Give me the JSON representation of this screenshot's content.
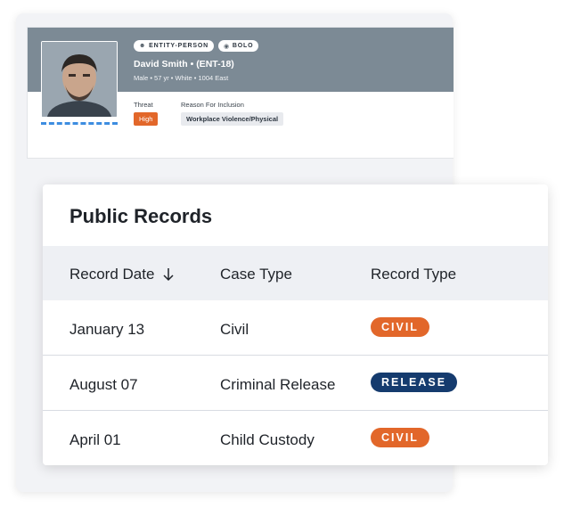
{
  "entity_card": {
    "tags": [
      {
        "icon": "person-icon",
        "label": "ENTITY-PERSON"
      },
      {
        "icon": "eye-icon",
        "label": "BOLO"
      }
    ],
    "name": "David Smith • (ENT-18)",
    "meta": "Male • 57 yr • White • 1004 East",
    "threat_label": "Threat",
    "threat_value": "High",
    "reason_label": "Reason For Inclusion",
    "reason_value": "Workplace Violence/Physical"
  },
  "public_records": {
    "title": "Public Records",
    "columns": [
      {
        "label": "Record Date",
        "sort_icon": "arrow-down-icon"
      },
      {
        "label": "Case Type"
      },
      {
        "label": "Record Type"
      }
    ],
    "rows": [
      {
        "date": "January 13",
        "case_type": "Civil",
        "record_type": "CIVIL",
        "record_color": "#e2672a"
      },
      {
        "date": "August 07",
        "case_type": "Criminal Release",
        "record_type": "RELEASE",
        "record_color": "#153b6e"
      },
      {
        "date": "April 01",
        "case_type": "Child Custody",
        "record_type": "CIVIL",
        "record_color": "#e2672a"
      }
    ]
  },
  "colors": {
    "header_band": "#7c8a95",
    "accent_orange": "#e2672a",
    "accent_navy": "#153b6e"
  }
}
